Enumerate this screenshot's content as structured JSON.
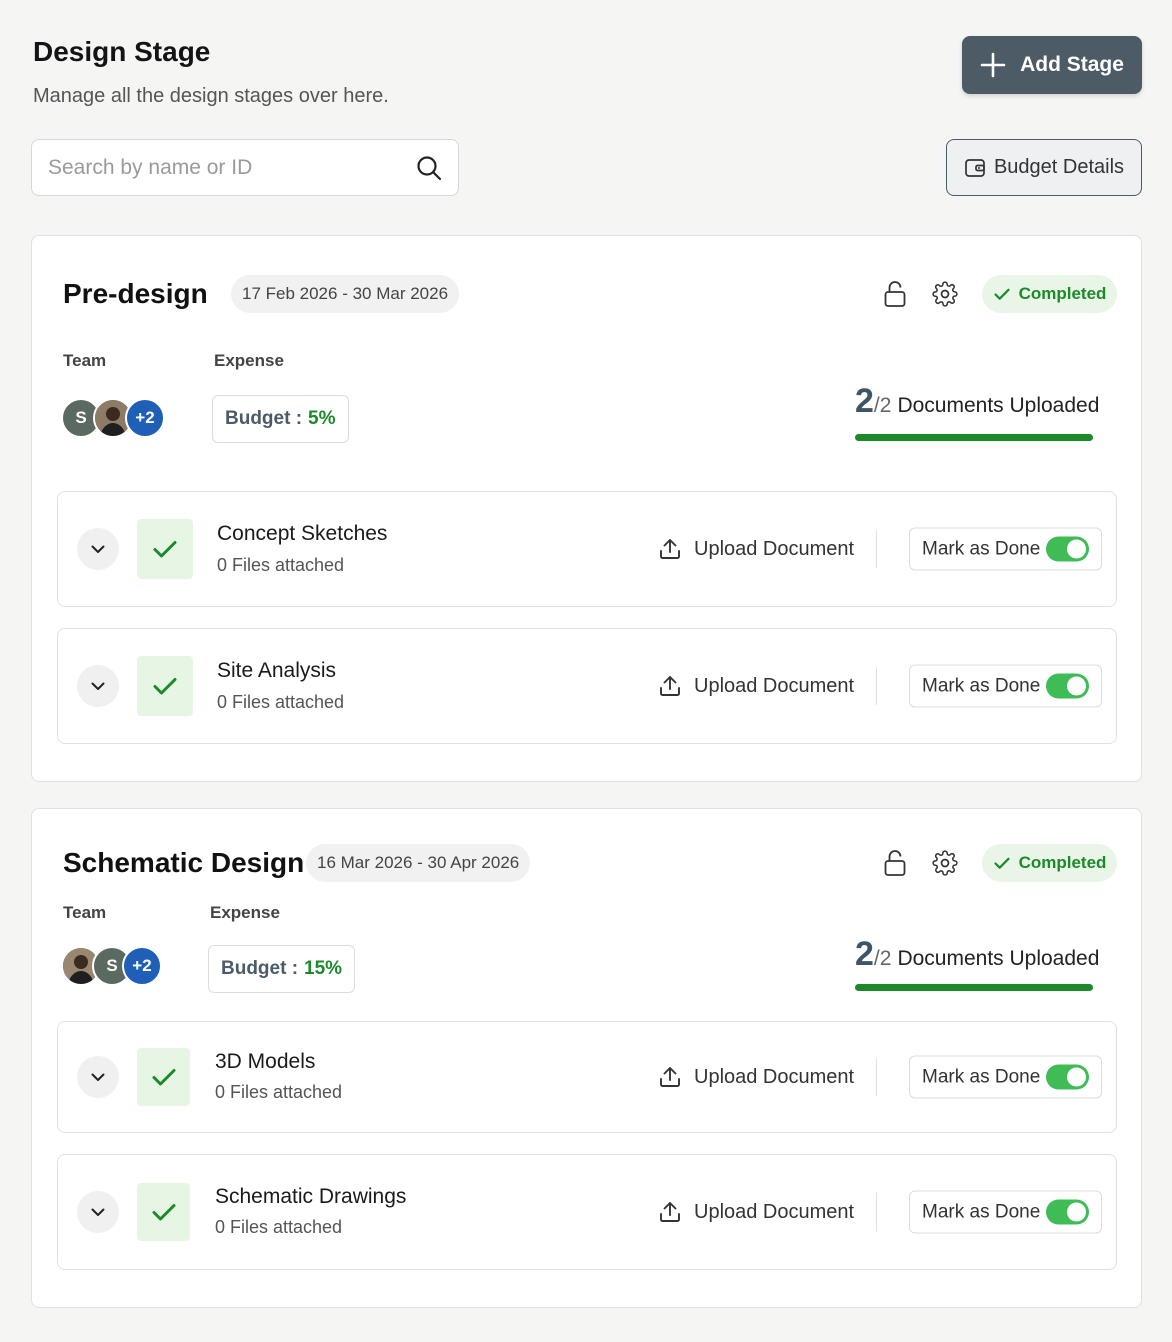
{
  "header": {
    "title": "Design Stage",
    "subtitle": "Manage all the design stages over here.",
    "add_stage_label": "Add Stage"
  },
  "search": {
    "placeholder": "Search by name or ID"
  },
  "budget_details_label": "Budget Details",
  "stages": [
    {
      "title": "Pre-design",
      "dates": "17 Feb 2026 - 30 Mar 2026",
      "status": "Completed",
      "team_label": "Team",
      "expense_label": "Expense",
      "team": {
        "initial": "S",
        "more": "+2"
      },
      "budget_label": "Budget :",
      "budget_value": "5%",
      "docs_uploaded": "2",
      "docs_total": "/2",
      "docs_label": "Documents Uploaded",
      "docs_progress": 1.0,
      "tasks": [
        {
          "name": "Concept Sketches",
          "files": "0 Files attached",
          "upload": "Upload Document",
          "mark": "Mark as Done",
          "done": true
        },
        {
          "name": "Site Analysis",
          "files": "0 Files attached",
          "upload": "Upload Document",
          "mark": "Mark as Done",
          "done": true
        }
      ]
    },
    {
      "title": "Schematic Design",
      "dates": "16 Mar 2026 - 30 Apr 2026",
      "status": "Completed",
      "team_label": "Team",
      "expense_label": "Expense",
      "team": {
        "initial": "S",
        "more": "+2"
      },
      "budget_label": "Budget :",
      "budget_value": "15%",
      "docs_uploaded": "2",
      "docs_total": "/2",
      "docs_label": "Documents Uploaded",
      "docs_progress": 1.0,
      "tasks": [
        {
          "name": "3D Models",
          "files": "0 Files attached",
          "upload": "Upload Document",
          "mark": "Mark as Done",
          "done": true
        },
        {
          "name": "Schematic Drawings",
          "files": "0 Files attached",
          "upload": "Upload Document",
          "mark": "Mark as Done",
          "done": true
        }
      ]
    }
  ],
  "colors": {
    "primary": "#4c5b66",
    "success": "#1d8a2a",
    "success_bg": "#e9f6e7",
    "toggle_on": "#3fbc56",
    "avatar_more": "#1f5fb8"
  }
}
